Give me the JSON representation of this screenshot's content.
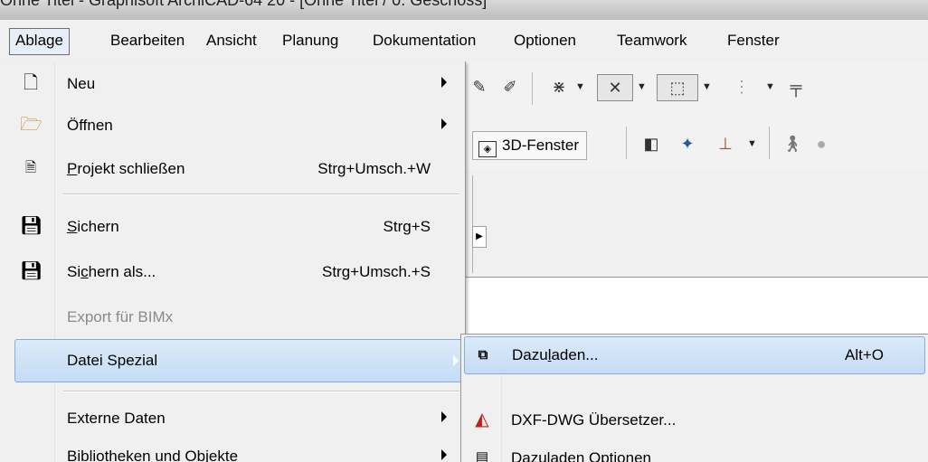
{
  "window": {
    "title": "Ohne Titel - Graphisoft ArchiCAD-64 20 - [Ohne Titel / 0. Geschoss]"
  },
  "menubar": {
    "items": [
      "Ablage",
      "Bearbeiten",
      "Ansicht",
      "Planung",
      "Dokumentation",
      "Optionen",
      "Teamwork",
      "Fenster"
    ],
    "active": "Ablage"
  },
  "toolbar": {
    "button_3d": "3D-Fenster"
  },
  "menu": {
    "items": [
      {
        "label": "Neu",
        "icon": "new-document-icon",
        "submenu": true
      },
      {
        "label": "Öffnen",
        "icon": "open-folder-icon",
        "submenu": true
      },
      {
        "label_pre": "",
        "label_u": "P",
        "label_post": "rojekt schließen",
        "shortcut": "Strg+Umsch.+W",
        "icon": "close-project-icon"
      },
      {
        "label_pre": "",
        "label_u": "S",
        "label_post": "ichern",
        "shortcut": "Strg+S",
        "icon": "save-icon"
      },
      {
        "label_pre": "Si",
        "label_u": "c",
        "label_post": "hern als...",
        "shortcut": "Strg+Umsch.+S",
        "icon": "save-as-icon"
      },
      {
        "label": "Export für BIMx",
        "disabled": true
      },
      {
        "label": "Datei Spezial",
        "submenu": true,
        "selected": true
      },
      {
        "label": "Externe Daten",
        "submenu": true
      },
      {
        "label": "Bibliotheken und Objekte",
        "submenu": true
      }
    ]
  },
  "submenu": {
    "items": [
      {
        "label_pre": "Dazu",
        "label_u": "l",
        "label_post": "aden...",
        "shortcut": "Alt+O",
        "icon": "merge-icon",
        "selected": true
      },
      {
        "label": "DXF-DWG Übersetzer...",
        "icon": "dxf-dwg-translator-icon"
      },
      {
        "label": "Dazuladen Optionen",
        "icon": "merge-options-icon"
      }
    ]
  }
}
